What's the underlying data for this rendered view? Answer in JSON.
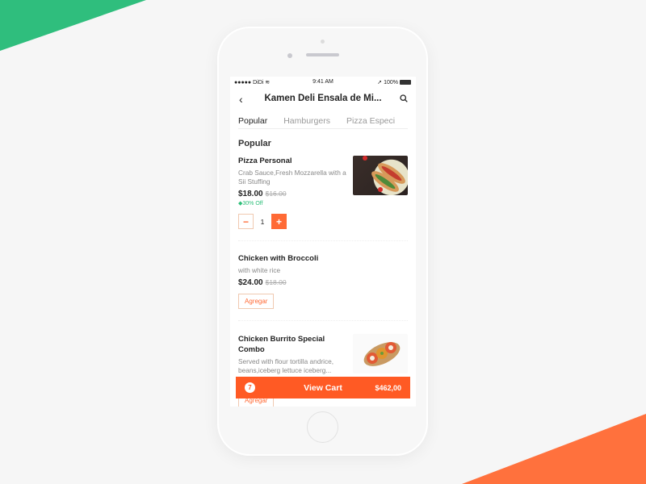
{
  "colors": {
    "accent": "#ff5a24",
    "green": "#2fbf7a",
    "tab_underline": "#e0563b"
  },
  "status_bar": {
    "carrier": "●●●●● DiDi",
    "time": "9:41 AM",
    "battery": "100%"
  },
  "header": {
    "title": "Kamen Deli Ensala de Mi...",
    "back_icon": "chevron-left-icon",
    "search_icon": "search-icon"
  },
  "tabs": [
    {
      "label": "Popular",
      "active": true
    },
    {
      "label": "Hamburgers",
      "active": false
    },
    {
      "label": "Pizza Especi",
      "active": false
    }
  ],
  "section_title": "Popular",
  "items": [
    {
      "name": "Pizza Personal",
      "description": "Crab Sauce,Fresh Mozzarella with a Sii Stuffing",
      "price": "$18.00",
      "old_price": "$16.00",
      "discount": "30% Off",
      "quantity": "1",
      "minus": "−",
      "plus": "+"
    },
    {
      "name": "Chicken with Broccoli",
      "description": "with white rice",
      "price": "$24.00",
      "old_price": "$18.00",
      "button": "Agregar"
    },
    {
      "name": "Chicken Burrito Special Combo",
      "description": "Served with flour tortilla andrice, beans,iceberg lettuce iceberg...",
      "button": "Agregar"
    }
  ],
  "cart": {
    "count": "7",
    "label": "View Cart",
    "total": "$462,00"
  }
}
